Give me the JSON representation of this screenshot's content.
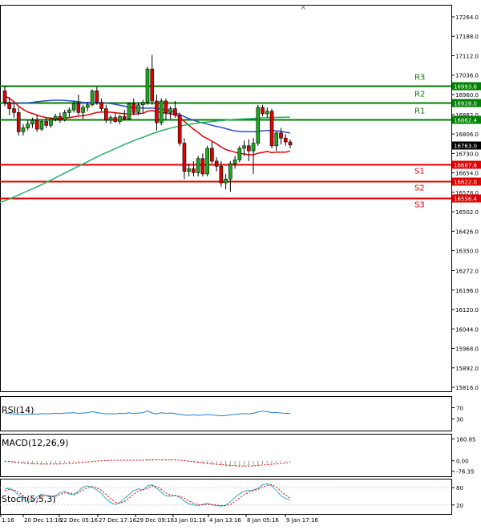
{
  "chart_data": [
    {
      "type": "candlestick",
      "panel": "price",
      "y_ticks": [
        17264.0,
        17188.0,
        17112.0,
        17036.0,
        16960.0,
        16882.0,
        16806.0,
        16730.0,
        16654.0,
        16578.0,
        16502.0,
        16426.0,
        16350.0,
        16272.0,
        16196.0,
        16120.0,
        16044.0,
        15968.0,
        15892.0,
        15816.0
      ],
      "y_tick_labels": [
        "17264.0",
        "17188.0",
        "17112.0",
        "17036.0",
        "16960.0",
        "16882.0",
        "16806.0",
        "16730.0",
        "16654.0",
        "16578.0",
        "16502.0",
        "16426.0",
        "16350.0",
        "16272.0",
        "16196.0",
        "16120.0",
        "16044.0",
        "15968.0",
        "15892.0",
        "15816.0"
      ],
      "ylim": [
        15800,
        17290
      ],
      "current_price": {
        "value": 16763.0,
        "label": "16763.0"
      },
      "levels": [
        {
          "name": "R3",
          "value": 16993.6,
          "label": "16993.6",
          "color": "#008000"
        },
        {
          "name": "R2",
          "value": 16928.0,
          "label": "16928.0",
          "color": "#008000"
        },
        {
          "name": "R1",
          "value": 16862.4,
          "label": "16862.4",
          "color": "#008000"
        },
        {
          "name": "S1",
          "value": 16687.6,
          "label": "16687.6",
          "color": "#e00000"
        },
        {
          "name": "S2",
          "value": 16622.0,
          "label": "16622.0",
          "color": "#e00000"
        },
        {
          "name": "S3",
          "value": 16556.4,
          "label": "16556.4",
          "color": "#e00000"
        }
      ],
      "x_labels": [
        "1:16",
        "20 Dec 13:16",
        "22 Dec 05:16",
        "27 Dec 17:16",
        "29 Dec 09:16",
        "3 Jan 01:16",
        "4 Jan 13:16",
        "8 Jan 05:16",
        "9 Jan 17:16"
      ],
      "candles": [
        {
          "o": 16975,
          "h": 16995,
          "l": 16915,
          "c": 16930
        },
        {
          "o": 16930,
          "h": 16950,
          "l": 16880,
          "c": 16905
        },
        {
          "o": 16905,
          "h": 16925,
          "l": 16870,
          "c": 16890
        },
        {
          "o": 16890,
          "h": 16910,
          "l": 16800,
          "c": 16815
        },
        {
          "o": 16815,
          "h": 16845,
          "l": 16800,
          "c": 16830
        },
        {
          "o": 16830,
          "h": 16860,
          "l": 16820,
          "c": 16845
        },
        {
          "o": 16845,
          "h": 16870,
          "l": 16830,
          "c": 16860
        },
        {
          "o": 16860,
          "h": 16880,
          "l": 16815,
          "c": 16825
        },
        {
          "o": 16825,
          "h": 16860,
          "l": 16818,
          "c": 16855
        },
        {
          "o": 16855,
          "h": 16870,
          "l": 16830,
          "c": 16840
        },
        {
          "o": 16840,
          "h": 16870,
          "l": 16830,
          "c": 16865
        },
        {
          "o": 16865,
          "h": 16885,
          "l": 16855,
          "c": 16875
        },
        {
          "o": 16875,
          "h": 16890,
          "l": 16850,
          "c": 16860
        },
        {
          "o": 16860,
          "h": 16900,
          "l": 16855,
          "c": 16890
        },
        {
          "o": 16890,
          "h": 16910,
          "l": 16870,
          "c": 16900
        },
        {
          "o": 16900,
          "h": 16935,
          "l": 16890,
          "c": 16925
        },
        {
          "o": 16925,
          "h": 16960,
          "l": 16880,
          "c": 16890
        },
        {
          "o": 16890,
          "h": 16920,
          "l": 16865,
          "c": 16910
        },
        {
          "o": 16910,
          "h": 16930,
          "l": 16895,
          "c": 16920
        },
        {
          "o": 16920,
          "h": 16980,
          "l": 16915,
          "c": 16975
        },
        {
          "o": 16975,
          "h": 16990,
          "l": 16920,
          "c": 16930
        },
        {
          "o": 16930,
          "h": 16945,
          "l": 16895,
          "c": 16905
        },
        {
          "o": 16905,
          "h": 16920,
          "l": 16850,
          "c": 16860
        },
        {
          "o": 16860,
          "h": 16880,
          "l": 16845,
          "c": 16870
        },
        {
          "o": 16870,
          "h": 16890,
          "l": 16850,
          "c": 16855
        },
        {
          "o": 16855,
          "h": 16880,
          "l": 16845,
          "c": 16875
        },
        {
          "o": 16875,
          "h": 16900,
          "l": 16860,
          "c": 16865
        },
        {
          "o": 16865,
          "h": 16930,
          "l": 16860,
          "c": 16925
        },
        {
          "o": 16925,
          "h": 16945,
          "l": 16880,
          "c": 16890
        },
        {
          "o": 16890,
          "h": 16930,
          "l": 16880,
          "c": 16920
        },
        {
          "o": 16920,
          "h": 16940,
          "l": 16890,
          "c": 16930
        },
        {
          "o": 16930,
          "h": 17070,
          "l": 16920,
          "c": 17060
        },
        {
          "o": 17060,
          "h": 17115,
          "l": 16920,
          "c": 16935
        },
        {
          "o": 16935,
          "h": 16960,
          "l": 16820,
          "c": 16850
        },
        {
          "o": 16850,
          "h": 16945,
          "l": 16840,
          "c": 16935
        },
        {
          "o": 16935,
          "h": 16945,
          "l": 16860,
          "c": 16890
        },
        {
          "o": 16890,
          "h": 16915,
          "l": 16865,
          "c": 16905
        },
        {
          "o": 16905,
          "h": 16935,
          "l": 16870,
          "c": 16880
        },
        {
          "o": 16880,
          "h": 16890,
          "l": 16760,
          "c": 16770
        },
        {
          "o": 16770,
          "h": 16790,
          "l": 16630,
          "c": 16660
        },
        {
          "o": 16660,
          "h": 16690,
          "l": 16640,
          "c": 16670
        },
        {
          "o": 16670,
          "h": 16700,
          "l": 16640,
          "c": 16655
        },
        {
          "o": 16655,
          "h": 16720,
          "l": 16640,
          "c": 16710
        },
        {
          "o": 16710,
          "h": 16730,
          "l": 16640,
          "c": 16650
        },
        {
          "o": 16650,
          "h": 16760,
          "l": 16640,
          "c": 16750
        },
        {
          "o": 16750,
          "h": 16775,
          "l": 16690,
          "c": 16700
        },
        {
          "o": 16700,
          "h": 16715,
          "l": 16660,
          "c": 16680
        },
        {
          "o": 16680,
          "h": 16700,
          "l": 16600,
          "c": 16615
        },
        {
          "o": 16615,
          "h": 16650,
          "l": 16590,
          "c": 16630
        },
        {
          "o": 16630,
          "h": 16700,
          "l": 16580,
          "c": 16690
        },
        {
          "o": 16690,
          "h": 16720,
          "l": 16670,
          "c": 16705
        },
        {
          "o": 16705,
          "h": 16760,
          "l": 16695,
          "c": 16750
        },
        {
          "o": 16750,
          "h": 16780,
          "l": 16720,
          "c": 16760
        },
        {
          "o": 16760,
          "h": 16785,
          "l": 16700,
          "c": 16740
        },
        {
          "o": 16740,
          "h": 16790,
          "l": 16650,
          "c": 16770
        },
        {
          "o": 16770,
          "h": 16920,
          "l": 16760,
          "c": 16910
        },
        {
          "o": 16910,
          "h": 16920,
          "l": 16875,
          "c": 16885
        },
        {
          "o": 16885,
          "h": 16910,
          "l": 16870,
          "c": 16895
        },
        {
          "o": 16895,
          "h": 16905,
          "l": 16750,
          "c": 16760
        },
        {
          "o": 16760,
          "h": 16815,
          "l": 16740,
          "c": 16810
        },
        {
          "o": 16810,
          "h": 16830,
          "l": 16765,
          "c": 16790
        },
        {
          "o": 16790,
          "h": 16805,
          "l": 16760,
          "c": 16775
        },
        {
          "o": 16775,
          "h": 16785,
          "l": 16750,
          "c": 16763
        }
      ],
      "series": [
        {
          "color": "#e00000",
          "values": [
            16955,
            16945,
            16932,
            16915,
            16902,
            16892,
            16886,
            16880,
            16874,
            16870,
            16868,
            16866,
            16866,
            16868,
            16870,
            16873,
            16876,
            16878,
            16881,
            16885,
            16890,
            16892,
            16892,
            16891,
            16889,
            16887,
            16885,
            16884,
            16884,
            16885,
            16887,
            16895,
            16898,
            16893,
            16890,
            16887,
            16885,
            16882,
            16872,
            16855,
            16840,
            16825,
            16812,
            16797,
            16788,
            16778,
            16768,
            16755,
            16745,
            16740,
            16735,
            16730,
            16728,
            16725,
            16725,
            16731,
            16734,
            16738,
            16733,
            16735,
            16735,
            16735,
            16740
          ]
        },
        {
          "color": "#2a4cd4",
          "values": [
            16925,
            16925,
            16925,
            16926,
            16926,
            16928,
            16930,
            16932,
            16934,
            16936,
            16937,
            16938,
            16938,
            16937,
            16936,
            16934,
            16932,
            16930,
            16929,
            16928,
            16928,
            16928,
            16927,
            16925,
            16922,
            16918,
            16915,
            16911,
            16909,
            16908,
            16907,
            16907,
            16907,
            16906,
            16904,
            16900,
            16896,
            16890,
            16882,
            16874,
            16866,
            16860,
            16854,
            16849,
            16845,
            16840,
            16836,
            16832,
            16827,
            16822,
            16818,
            16816,
            16815,
            16815,
            16815,
            16816,
            16818,
            16820,
            16820,
            16818,
            16816,
            16813,
            16810
          ]
        },
        {
          "color": "#26b06a",
          "values": [
            16545,
            16552,
            16560,
            16568,
            16576,
            16584,
            16592,
            16600,
            16608,
            16617,
            16626,
            16635,
            16644,
            16653,
            16662,
            16671,
            16680,
            16689,
            16698,
            16707,
            16716,
            16725,
            16733,
            16741,
            16749,
            16757,
            16765,
            16772,
            16780,
            16787,
            16793,
            16800,
            16807,
            16813,
            16819,
            16824,
            16829,
            16833,
            16837,
            16840,
            16843,
            16846,
            16849,
            16851,
            16853,
            16855,
            16857,
            16858,
            16860,
            16862,
            16863,
            16864,
            16865,
            16866,
            16867,
            16868,
            16869,
            16870,
            16870,
            16871,
            16871,
            16872,
            16872
          ]
        }
      ]
    },
    {
      "type": "line",
      "panel": "rsi",
      "title": "RSI(14)",
      "y_tick_labels": [
        "70",
        "30"
      ],
      "ylim": [
        0,
        100
      ],
      "series": [
        {
          "color": "#1e7fd6",
          "values": [
            50,
            49,
            48,
            47,
            46,
            47,
            48,
            47,
            49,
            48,
            49,
            50,
            49,
            51,
            51,
            52,
            50,
            51,
            52,
            56,
            53,
            50,
            48,
            49,
            48,
            50,
            49,
            52,
            49,
            51,
            52,
            59,
            51,
            48,
            52,
            50,
            51,
            49,
            46,
            44,
            43,
            45,
            43,
            44,
            46,
            44,
            43,
            41,
            42,
            45,
            46,
            48,
            49,
            48,
            50,
            55,
            58,
            56,
            52,
            53,
            51,
            50,
            50
          ]
        }
      ]
    },
    {
      "type": "bar",
      "panel": "macd",
      "title": "MACD(12,26,9)",
      "y_tick_labels": [
        "160.85",
        "0.00",
        "-76.35"
      ],
      "ylim": [
        -90,
        175
      ],
      "series": [
        {
          "name": "histogram",
          "color": "#9a9a9a",
          "values": [
            -5,
            -8,
            -12,
            -16,
            -20,
            -24,
            -26,
            -27,
            -27,
            -27,
            -26,
            -24,
            -22,
            -19,
            -16,
            -13,
            -10,
            -7,
            -4,
            -1,
            2,
            4,
            5,
            5,
            5,
            4,
            3,
            3,
            3,
            4,
            5,
            10,
            12,
            11,
            10,
            9,
            8,
            6,
            3,
            -3,
            -8,
            -14,
            -18,
            -22,
            -25,
            -28,
            -31,
            -35,
            -39,
            -41,
            -42,
            -42,
            -40,
            -38,
            -36,
            -30,
            -25,
            -21,
            -19,
            -16,
            -12,
            -8,
            -5
          ]
        },
        {
          "name": "signal",
          "color": "#e00000",
          "values": [
            -3,
            -6,
            -9,
            -12,
            -15,
            -18,
            -20,
            -22,
            -23,
            -24,
            -24,
            -24,
            -23,
            -21,
            -19,
            -17,
            -14,
            -11,
            -8,
            -5,
            -2,
            0,
            2,
            3,
            4,
            4,
            4,
            4,
            4,
            4,
            5,
            6,
            7,
            8,
            8,
            8,
            8,
            7,
            5,
            2,
            -2,
            -6,
            -10,
            -14,
            -18,
            -22,
            -25,
            -28,
            -31,
            -34,
            -36,
            -38,
            -38,
            -38,
            -37,
            -34,
            -31,
            -28,
            -25,
            -22,
            -19,
            -15,
            -11
          ]
        }
      ]
    },
    {
      "type": "line",
      "panel": "stochastic",
      "title": "Stoch(5,5,3)",
      "y_tick_labels": [
        "80",
        "20"
      ],
      "ylim": [
        0,
        100
      ],
      "series": [
        {
          "name": "main",
          "color": "#2eaac8",
          "values": [
            75,
            78,
            68,
            55,
            40,
            32,
            35,
            48,
            58,
            52,
            46,
            52,
            62,
            68,
            58,
            55,
            68,
            82,
            86,
            82,
            72,
            60,
            42,
            28,
            22,
            28,
            42,
            56,
            70,
            76,
            72,
            86,
            90,
            78,
            64,
            52,
            50,
            54,
            46,
            34,
            24,
            20,
            18,
            22,
            26,
            20,
            18,
            16,
            20,
            32,
            46,
            58,
            68,
            70,
            72,
            78,
            90,
            94,
            86,
            70,
            52,
            42,
            38
          ]
        },
        {
          "name": "signal",
          "color": "#e00000",
          "values": [
            70,
            74,
            72,
            64,
            52,
            42,
            36,
            40,
            48,
            54,
            50,
            50,
            56,
            62,
            62,
            58,
            62,
            72,
            80,
            84,
            80,
            70,
            56,
            42,
            30,
            26,
            32,
            44,
            58,
            68,
            72,
            78,
            86,
            84,
            74,
            62,
            54,
            52,
            50,
            44,
            34,
            26,
            21,
            20,
            22,
            22,
            20,
            18,
            18,
            22,
            32,
            44,
            56,
            64,
            70,
            74,
            82,
            88,
            90,
            82,
            68,
            54,
            44
          ]
        }
      ]
    }
  ]
}
